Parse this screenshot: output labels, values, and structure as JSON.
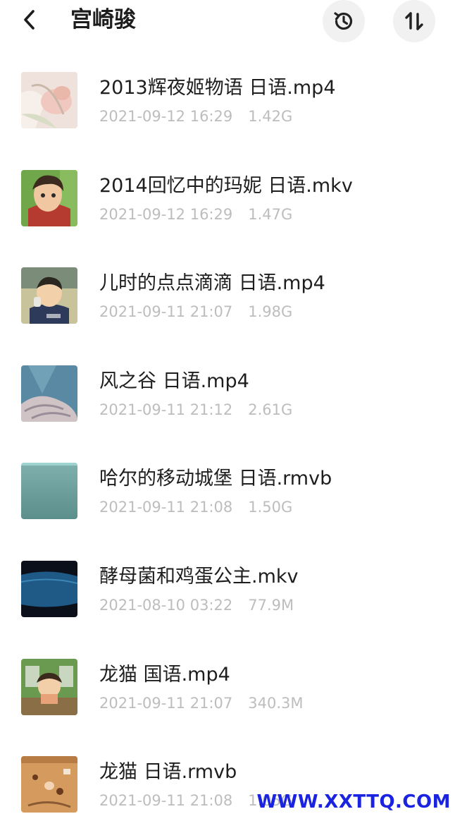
{
  "header": {
    "title": "宫崎骏",
    "back_icon": "chevron-left-icon",
    "history_icon": "history-icon",
    "sort_icon": "sort-icon"
  },
  "files": [
    {
      "name": "2013辉夜姬物语 日语.mp4",
      "date": "2021-09-12 16:29",
      "size": "1.42G"
    },
    {
      "name": "2014回忆中的玛妮 日语.mkv",
      "date": "2021-09-12 16:29",
      "size": "1.47G"
    },
    {
      "name": "儿时的点点滴滴 日语.mp4",
      "date": "2021-09-11 21:07",
      "size": "1.98G"
    },
    {
      "name": "风之谷 日语.mp4",
      "date": "2021-09-11 21:12",
      "size": "2.61G"
    },
    {
      "name": "哈尔的移动城堡 日语.rmvb",
      "date": "2021-09-11 21:08",
      "size": "1.50G"
    },
    {
      "name": "酵母菌和鸡蛋公主.mkv",
      "date": "2021-08-10 03:22",
      "size": "77.9M"
    },
    {
      "name": "龙猫 国语.mp4",
      "date": "2021-09-11 21:07",
      "size": "340.3M"
    },
    {
      "name": "龙猫 日语.rmvb",
      "date": "2021-09-11 21:08",
      "size": "1.05G"
    }
  ],
  "watermark": "WWW.XXTTQ.COM"
}
